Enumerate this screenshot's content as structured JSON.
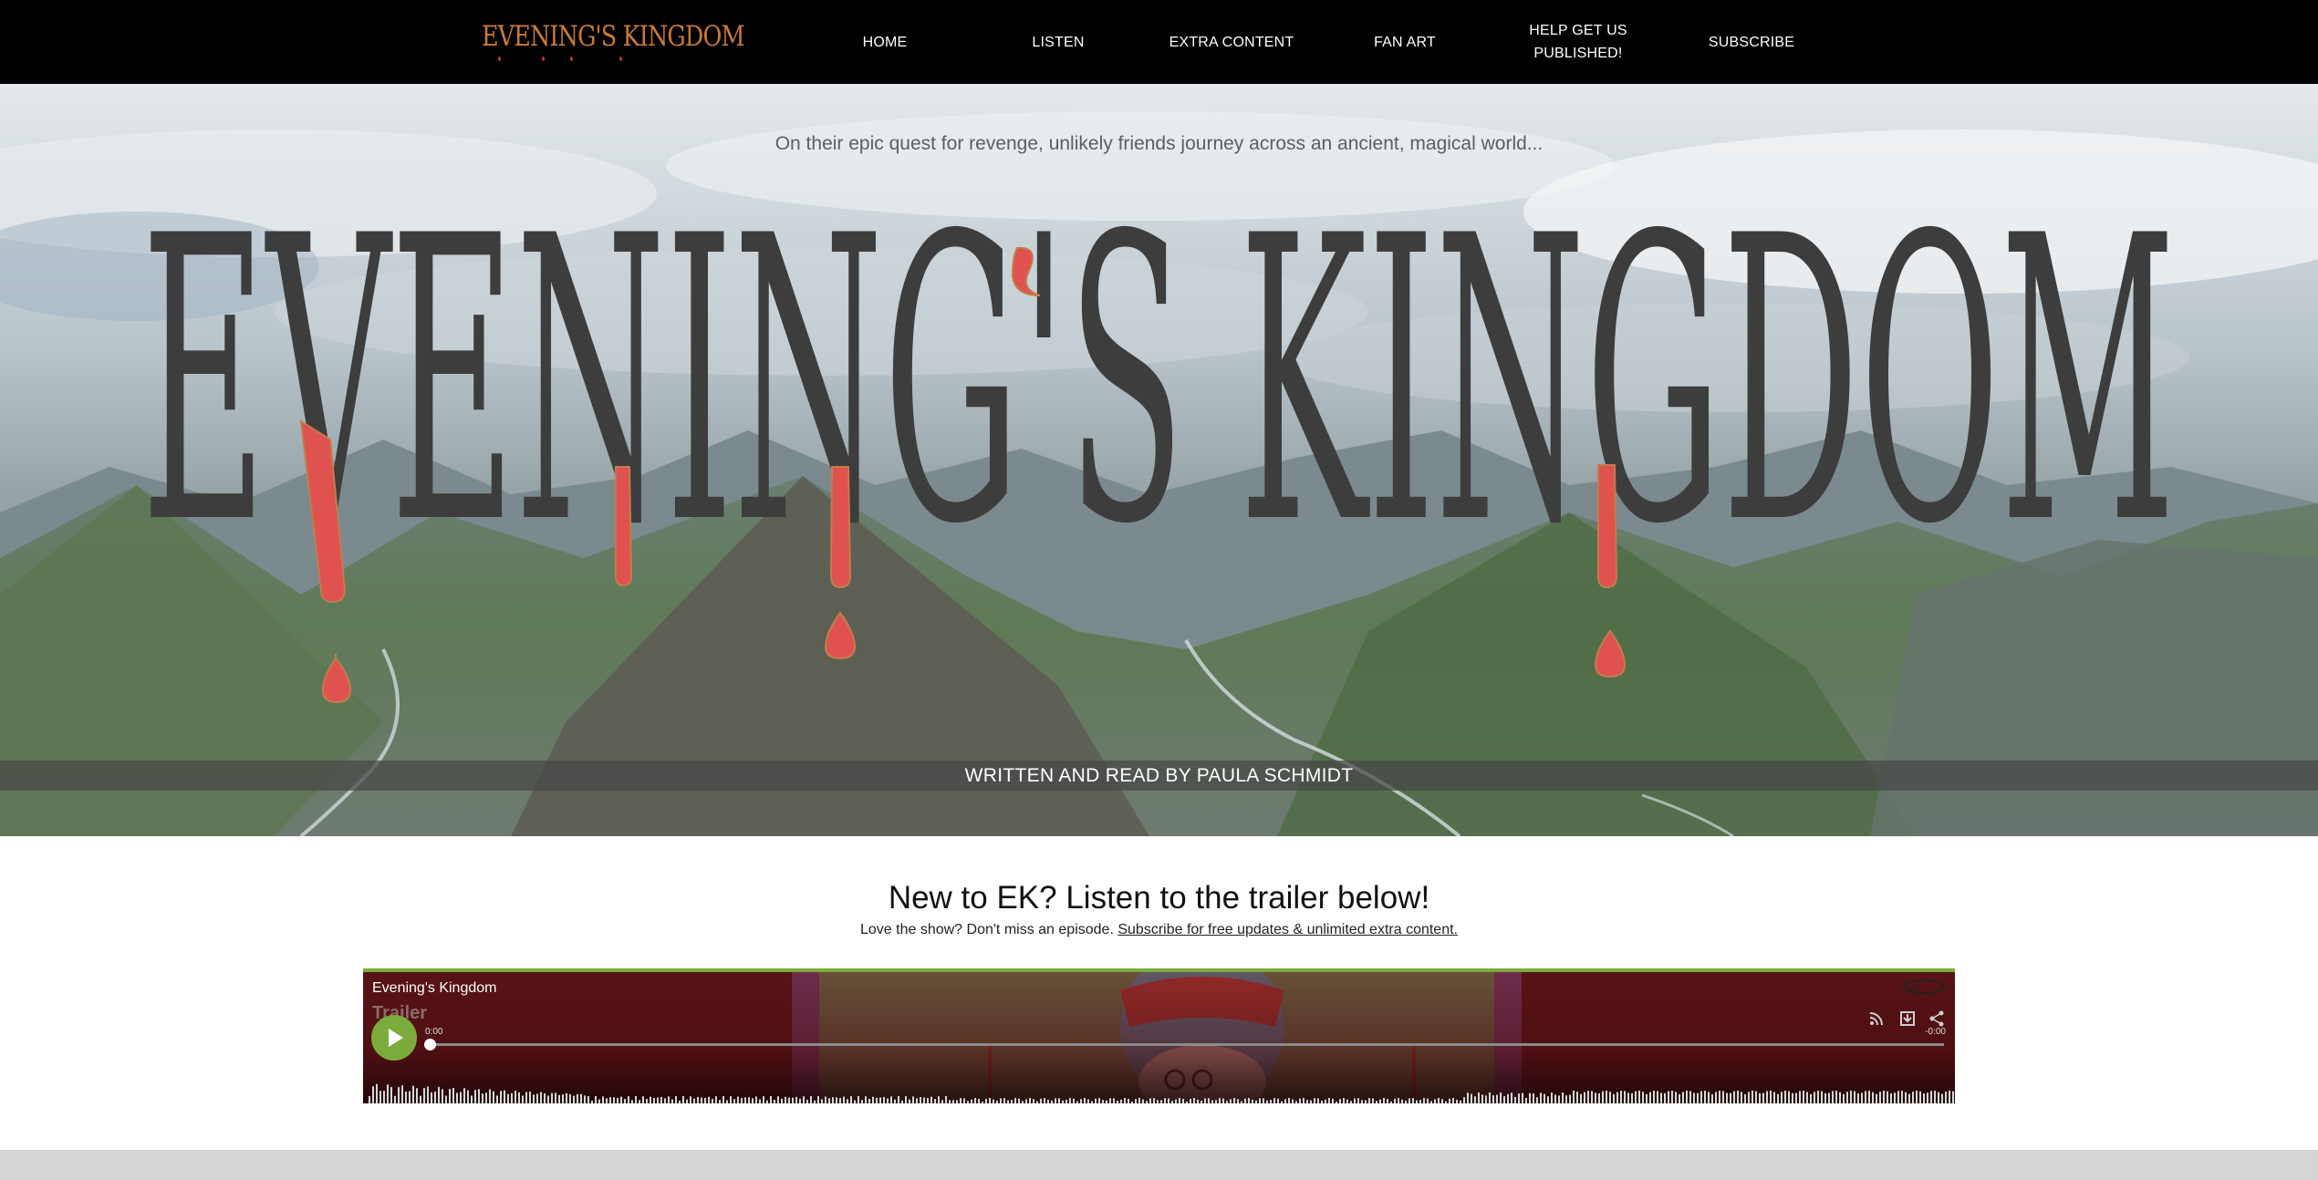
{
  "nav": {
    "logo_text": "EVENING'S KINGDOM",
    "items": [
      {
        "label": "HOME"
      },
      {
        "label": "LISTEN"
      },
      {
        "label": "EXTRA CONTENT"
      },
      {
        "label": "FAN ART"
      },
      {
        "label": "HELP GET US PUBLISHED!"
      },
      {
        "label": "SUBSCRIBE"
      }
    ]
  },
  "hero": {
    "tagline": "On their epic quest for revenge, unlikely friends journey across an ancient, magical world...",
    "title": "EVENING'S KINGDOM",
    "credit": "WRITTEN AND READ BY PAULA SCHMIDT"
  },
  "intro": {
    "heading": "New to EK? Listen to the trailer below!",
    "subline": "Love the show? Don't miss an episode.",
    "subscribe_link": "Subscribe for free updates & unlimited extra content."
  },
  "player": {
    "show_title": "Evening's Kingdom",
    "episode_title": "Trailer",
    "time_elapsed": "0:00",
    "time_remaining": "-0:00",
    "progress": 0,
    "icons": [
      "rss-icon",
      "download-icon",
      "share-icon"
    ],
    "brand_icon": "podbean-logo-icon"
  },
  "colors": {
    "accent_green": "#7bab3a",
    "logo_orange": "#c97a36",
    "title_gray": "#3d3d3d",
    "blood_red": "#e0524f",
    "player_bg": "#4a1216"
  }
}
